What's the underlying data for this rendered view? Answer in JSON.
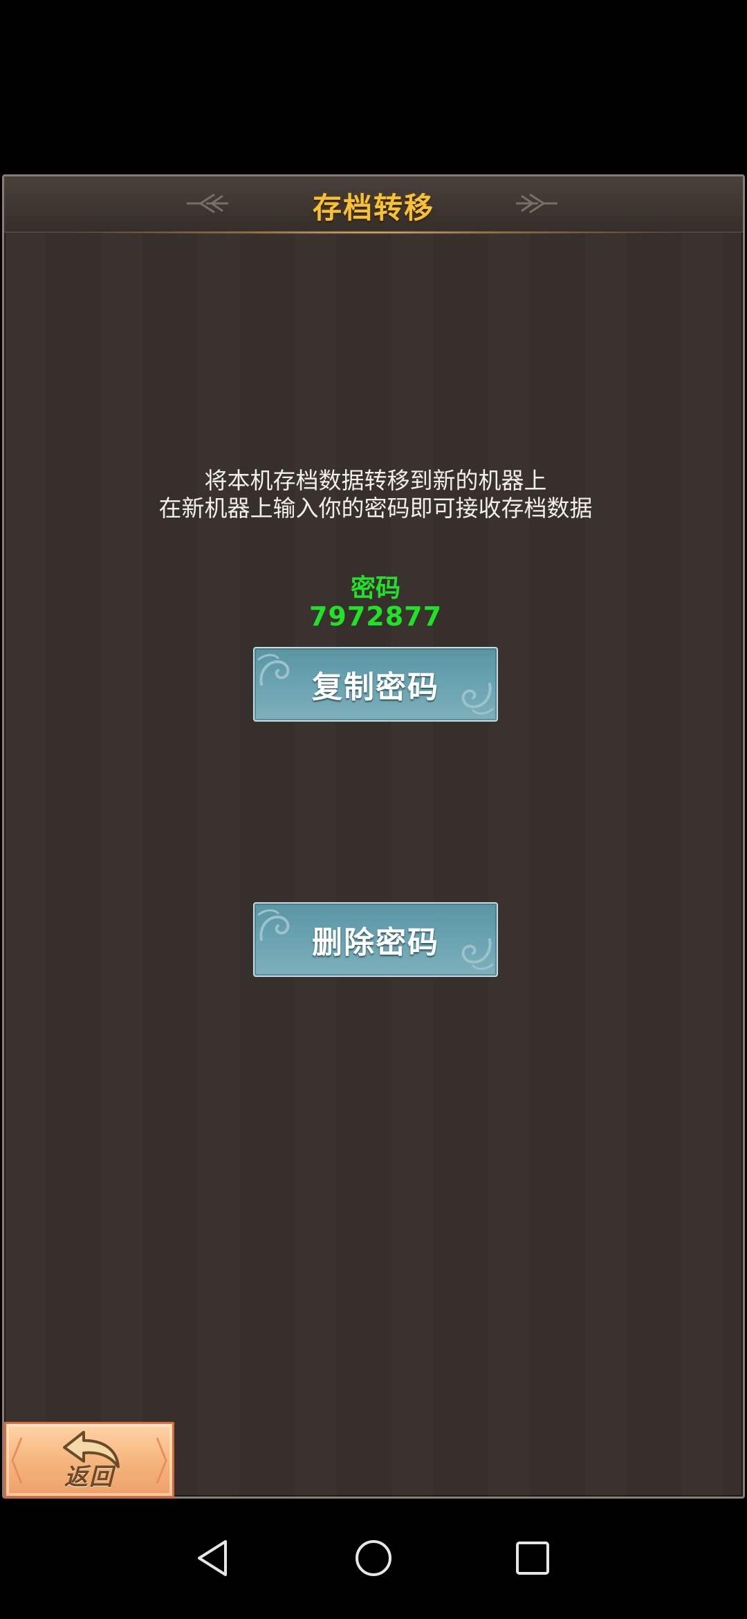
{
  "dialog": {
    "title": "存档转移",
    "description_line1": "将本机存档数据转移到新的机器上",
    "description_line2": "在新机器上输入你的密码即可接收存档数据",
    "password_label": "密码",
    "password_value": "7972877"
  },
  "buttons": {
    "copy_label": "复制密码",
    "delete_label": "删除密码",
    "back_label": "返回"
  },
  "colors": {
    "title": "#f6c13a",
    "password": "#23e02b",
    "panel_bg": "#38302c",
    "button_bg": "#6aa3b1",
    "back_button_bg": "#f5b47c"
  },
  "icons": {
    "back_button": "return-arrow-icon",
    "nav_back": "triangle-back-icon",
    "nav_home": "circle-home-icon",
    "nav_recent": "square-recent-icon"
  }
}
